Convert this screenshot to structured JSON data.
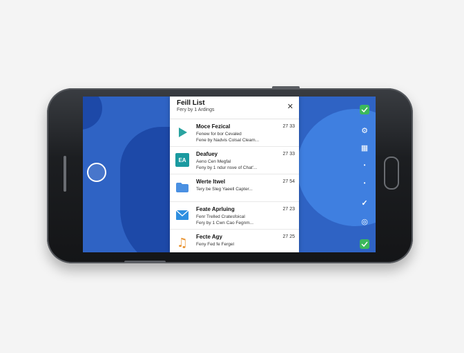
{
  "panel": {
    "title": "Feill List",
    "subtitle": "Fery by 1 Ardings",
    "close_icon": "close-icon",
    "items": [
      {
        "title": "Moce Fezical",
        "time": "27 33",
        "line1": "Fenew for bor Cevaled",
        "line2": "Fene by Nadvis Colsal Cleam...",
        "icon": "play-icon",
        "icon_color": "#2aa3a0"
      },
      {
        "title": "Deafuey",
        "time": "27 33",
        "line1": "Aeno Cen Megfal",
        "line2": "Feny by 1 ndur nsve of Chat'...",
        "icon": "ea-badge-icon",
        "icon_color": "#1a9aa0",
        "badge_text": "EA"
      },
      {
        "title": "Werte ltwel",
        "time": "27 54",
        "line1": "Tery be Sleg Yaeell Capter...",
        "line2": "",
        "icon": "folder-icon",
        "icon_color": "#4a90e2"
      },
      {
        "title": "Feate Aprluing",
        "time": "27 23",
        "line1": "Fenr Trelled Cratesfoical",
        "line2": "Fery by 1 Cwn Cao Fegnm...",
        "icon": "mail-icon",
        "icon_color": "#2f8fe0"
      },
      {
        "title": "Fecte Agy",
        "time": "27 25",
        "line1": "Feny Fed fe Fergel",
        "line2": "",
        "icon": "music-note-icon",
        "icon_color": "#e8922e"
      }
    ]
  },
  "right_icons": [
    "signal-icon",
    "settings-icon",
    "grid-icon",
    "dot-icon",
    "dot-icon",
    "check-icon",
    "globe-icon",
    "status-icon"
  ],
  "colors": {
    "screen_bg": "#2f63c4",
    "accent_green": "#3cb85c"
  }
}
